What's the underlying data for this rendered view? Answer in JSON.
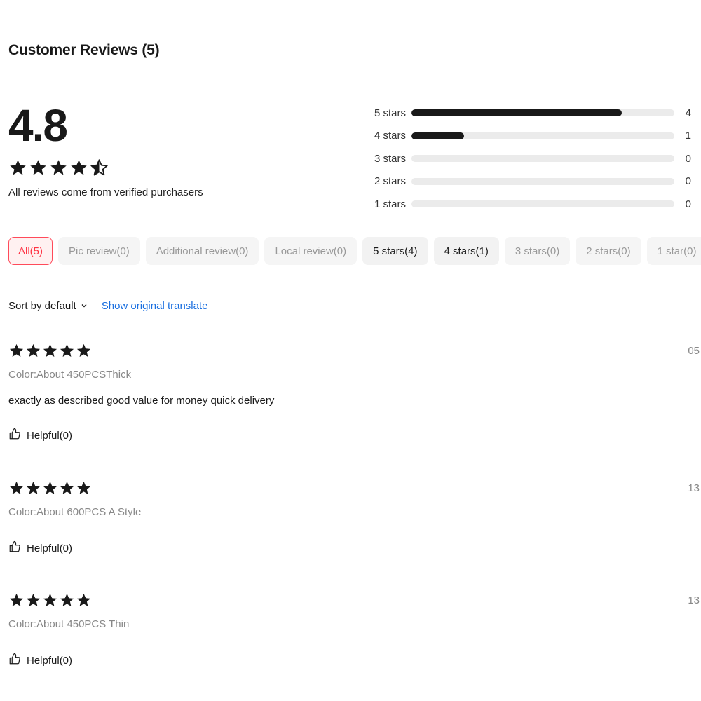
{
  "header": {
    "title": "Customer Reviews (5)"
  },
  "summary": {
    "score": "4.8",
    "rating": 4.8,
    "note": "All reviews come from verified purchasers"
  },
  "distribution": [
    {
      "label": "5 stars",
      "count": "4",
      "fraction": 0.8
    },
    {
      "label": "4 stars",
      "count": "1",
      "fraction": 0.2
    },
    {
      "label": "3 stars",
      "count": "0",
      "fraction": 0
    },
    {
      "label": "2 stars",
      "count": "0",
      "fraction": 0
    },
    {
      "label": "1 stars",
      "count": "0",
      "fraction": 0
    }
  ],
  "filters": [
    {
      "label": "All(5)",
      "state": "active"
    },
    {
      "label": "Pic review(0)",
      "state": "disabled"
    },
    {
      "label": "Additional review(0)",
      "state": "disabled"
    },
    {
      "label": "Local review(0)",
      "state": "disabled"
    },
    {
      "label": "5 stars(4)",
      "state": "enabled"
    },
    {
      "label": "4 stars(1)",
      "state": "enabled"
    },
    {
      "label": "3 stars(0)",
      "state": "disabled"
    },
    {
      "label": "2 stars(0)",
      "state": "disabled"
    },
    {
      "label": "1 star(0)",
      "state": "disabled"
    }
  ],
  "sort": {
    "label": "Sort by default",
    "translate_link": "Show original translate"
  },
  "reviews": [
    {
      "rating": 5,
      "date": "05",
      "sku": "Color:About 450PCSThick",
      "text": "exactly as described good value for money quick delivery",
      "helpful": "Helpful(0)"
    },
    {
      "rating": 5,
      "date": "13",
      "sku": "Color:About 600PCS A Style",
      "text": "",
      "helpful": "Helpful(0)"
    },
    {
      "rating": 5,
      "date": "13",
      "sku": "Color:About 450PCS Thin",
      "text": "",
      "helpful": "Helpful(0)"
    }
  ],
  "colors": {
    "star": "#191919",
    "accent": "#ff3344",
    "link": "#1a6fe0",
    "bar": "#191919",
    "track": "#ebebeb"
  },
  "icons": {
    "star": "star-icon",
    "half_star": "star-half-icon",
    "helpful": "thumbs-up-icon",
    "sort": "chevron-down-icon"
  }
}
